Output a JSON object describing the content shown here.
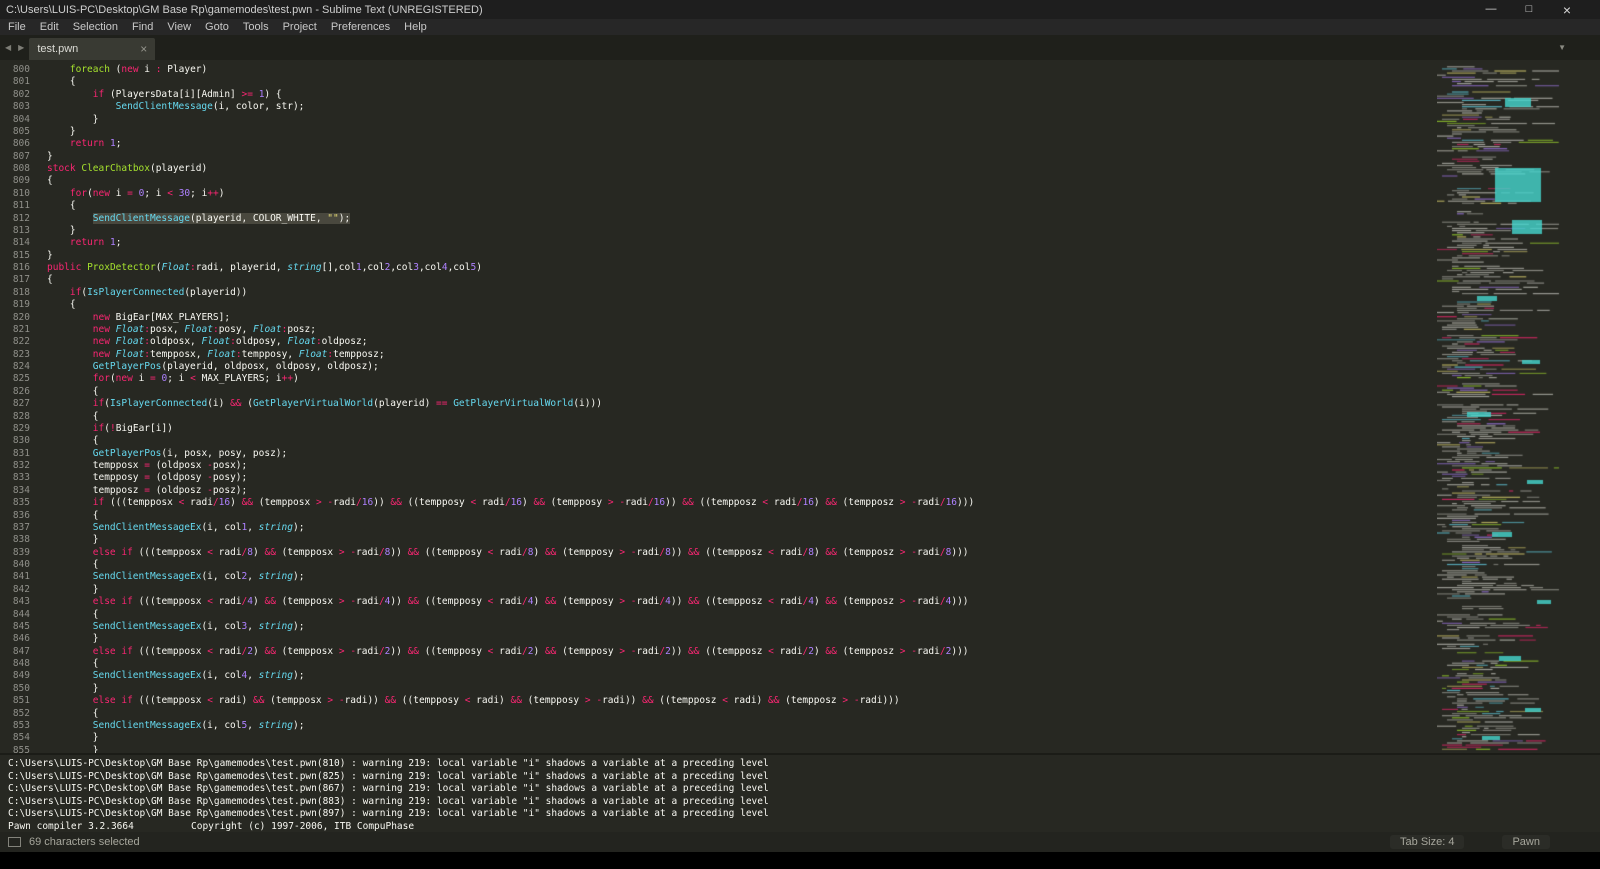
{
  "window": {
    "title": "C:\\Users\\LUIS-PC\\Desktop\\GM Base Rp\\gamemodes\\test.pwn - Sublime Text (UNREGISTERED)",
    "controls": {
      "minimize": "—",
      "restore": "□",
      "close": "×"
    }
  },
  "menu": {
    "items": [
      "File",
      "Edit",
      "Selection",
      "Find",
      "View",
      "Goto",
      "Tools",
      "Project",
      "Preferences",
      "Help"
    ]
  },
  "tabs": {
    "nav_left": "◀",
    "nav_right": "▶",
    "overflow": "▼",
    "active": {
      "label": "test.pwn",
      "close": "×"
    }
  },
  "editor": {
    "first_line_number": 800,
    "selection": {
      "line": 812
    },
    "lines": [
      "    foreach (new i : Player)",
      "    {",
      "        if (PlayersData[i][Admin] >= 1) {",
      "            SendClientMessage(i, color, str);",
      "        }",
      "    }",
      "    return 1;",
      "}",
      "stock ClearChatbox(playerid)",
      "{",
      "    for(new i = 0; i < 30; i++)",
      "    {",
      "        SendClientMessage(playerid, COLOR_WHITE, \"\");",
      "    }",
      "    return 1;",
      "}",
      "public ProxDetector(Float:radi, playerid, string[],col1,col2,col3,col4,col5)",
      "{",
      "    if(IsPlayerConnected(playerid))",
      "    {",
      "        new BigEar[MAX_PLAYERS];",
      "        new Float:posx, Float:posy, Float:posz;",
      "        new Float:oldposx, Float:oldposy, Float:oldposz;",
      "        new Float:tempposx, Float:tempposy, Float:tempposz;",
      "        GetPlayerPos(playerid, oldposx, oldposy, oldposz);",
      "        for(new i = 0; i < MAX_PLAYERS; i++)",
      "        {",
      "        if(IsPlayerConnected(i) && (GetPlayerVirtualWorld(playerid) == GetPlayerVirtualWorld(i)))",
      "        {",
      "        if(!BigEar[i])",
      "        {",
      "        GetPlayerPos(i, posx, posy, posz);",
      "        tempposx = (oldposx -posx);",
      "        tempposy = (oldposy -posy);",
      "        tempposz = (oldposz -posz);",
      "        if (((tempposx < radi/16) && (tempposx > -radi/16)) && ((tempposy < radi/16) && (tempposy > -radi/16)) && ((tempposz < radi/16) && (tempposz > -radi/16)))",
      "        {",
      "        SendClientMessageEx(i, col1, string);",
      "        }",
      "        else if (((tempposx < radi/8) && (tempposx > -radi/8)) && ((tempposy < radi/8) && (tempposy > -radi/8)) && ((tempposz < radi/8) && (tempposz > -radi/8)))",
      "        {",
      "        SendClientMessageEx(i, col2, string);",
      "        }",
      "        else if (((tempposx < radi/4) && (tempposx > -radi/4)) && ((tempposy < radi/4) && (tempposy > -radi/4)) && ((tempposz < radi/4) && (tempposz > -radi/4)))",
      "        {",
      "        SendClientMessageEx(i, col3, string);",
      "        }",
      "        else if (((tempposx < radi/2) && (tempposx > -radi/2)) && ((tempposy < radi/2) && (tempposy > -radi/2)) && ((tempposz < radi/2) && (tempposz > -radi/2)))",
      "        {",
      "        SendClientMessageEx(i, col4, string);",
      "        }",
      "        else if (((tempposx < radi) && (tempposx > -radi)) && ((tempposy < radi) && (tempposy > -radi)) && ((tempposz < radi) && (tempposz > -radi)))",
      "        {",
      "        SendClientMessageEx(i, col5, string);",
      "        }",
      "        }",
      "    }"
    ]
  },
  "build_output": {
    "lines": [
      "C:\\Users\\LUIS-PC\\Desktop\\GM Base Rp\\gamemodes\\test.pwn(810) : warning 219: local variable \"i\" shadows a variable at a preceding level",
      "C:\\Users\\LUIS-PC\\Desktop\\GM Base Rp\\gamemodes\\test.pwn(825) : warning 219: local variable \"i\" shadows a variable at a preceding level",
      "C:\\Users\\LUIS-PC\\Desktop\\GM Base Rp\\gamemodes\\test.pwn(867) : warning 219: local variable \"i\" shadows a variable at a preceding level",
      "C:\\Users\\LUIS-PC\\Desktop\\GM Base Rp\\gamemodes\\test.pwn(883) : warning 219: local variable \"i\" shadows a variable at a preceding level",
      "C:\\Users\\LUIS-PC\\Desktop\\GM Base Rp\\gamemodes\\test.pwn(897) : warning 219: local variable \"i\" shadows a variable at a preceding level",
      "Pawn compiler 3.2.3664          Copyright (c) 1997-2006, ITB CompuPhase"
    ]
  },
  "status_bar": {
    "left": "69 characters selected",
    "tab_size": "Tab Size: 4",
    "syntax": "Pawn"
  },
  "colors": {
    "background": "#272822",
    "foreground": "#f8f8f2",
    "keyword": "#f92672",
    "function_call": "#66d9ef",
    "definition": "#a6e22e",
    "number": "#ae81ff",
    "string": "#e6db74",
    "line_number": "#90908a",
    "selection": "#49483e"
  }
}
